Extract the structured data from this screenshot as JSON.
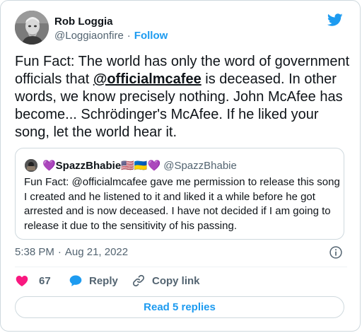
{
  "author": {
    "name": "Rob Loggia",
    "handle": "@Loggiaonfire",
    "separator": "·",
    "follow_label": "Follow"
  },
  "tweet": {
    "text_before": "Fun Fact: The world has only the word of government officials that ",
    "mention": "@officialmcafee",
    "text_after": " is deceased. In other words, we know precisely nothing. John McAfee has become... Schrödinger's McAfee. If he liked your song, let the world hear it.",
    "time": "5:38 PM",
    "separator": "·",
    "date": "Aug 21, 2022"
  },
  "quoted": {
    "name": "💜SpazzBhabie🇺🇸🇺🇦💜",
    "handle": "@SpazzBhabie",
    "text": "Fun Fact: @officialmcafee gave me permission to release this song I created and he listened to it and liked it a while before he got arrested and is now deceased. I have not decided if I am going to release it due to the sensitivity of his passing."
  },
  "actions": {
    "like_count": "67",
    "reply_label": "Reply",
    "copy_label": "Copy link"
  },
  "read_replies_label": "Read 5 replies",
  "icons": {
    "brand": "twitter-bird-icon",
    "like": "heart-icon",
    "reply": "speech-bubble-icon",
    "copy": "link-icon",
    "info": "info-icon"
  },
  "colors": {
    "brand": "#1d9bf0",
    "like": "#f91880",
    "text": "#0f1419",
    "muted": "#536471",
    "border": "#cfd9de"
  }
}
